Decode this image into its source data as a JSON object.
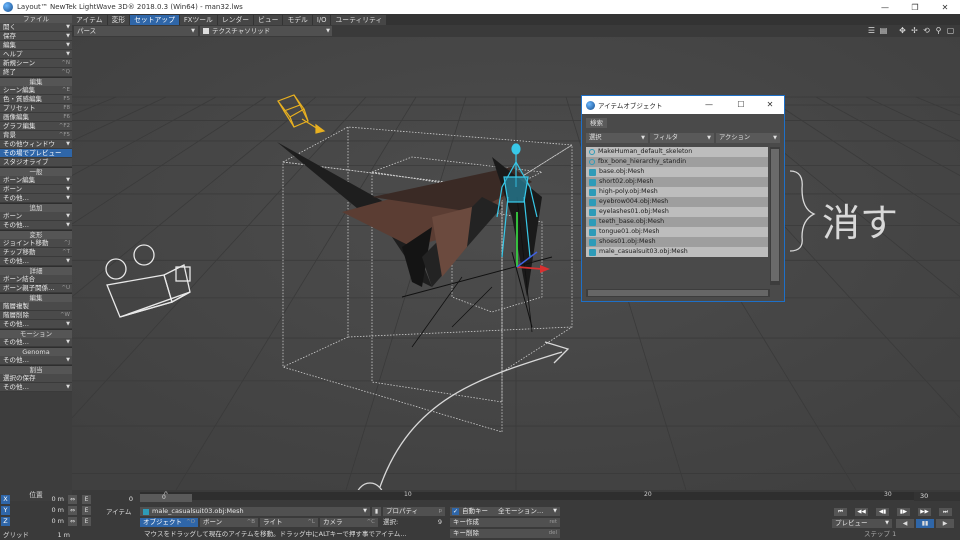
{
  "window": {
    "title": "Layout™ NewTek LightWave 3D® 2018.0.3 (Win64) - man32.lws",
    "minimize": "—",
    "maximize": "❐",
    "close": "✕"
  },
  "menu_tabs": [
    "アイテム",
    "変形",
    "セットアップ",
    "FXツール",
    "レンダー",
    "ビュー",
    "モデル",
    "I/O",
    "ユーティリティ"
  ],
  "active_tab": "セットアップ",
  "left_panel": [
    {
      "type": "header",
      "label": "ファイル"
    },
    {
      "type": "item",
      "label": "開く",
      "dropdown": true
    },
    {
      "type": "item",
      "label": "保存",
      "dropdown": true
    },
    {
      "type": "item",
      "label": "編集",
      "dropdown": true
    },
    {
      "type": "item",
      "label": "ヘルプ",
      "dropdown": true
    },
    {
      "type": "item",
      "label": "新規シーン",
      "shortcut": "^N"
    },
    {
      "type": "item",
      "label": "終了",
      "shortcut": "^Q"
    },
    {
      "type": "header",
      "label": "編集"
    },
    {
      "type": "item",
      "label": "シーン編集",
      "shortcut": "^E"
    },
    {
      "type": "item",
      "label": "色・質感編集",
      "shortcut": "F5"
    },
    {
      "type": "item",
      "label": "プリセット",
      "shortcut": "F8"
    },
    {
      "type": "item",
      "label": "画像編集",
      "shortcut": "F6"
    },
    {
      "type": "item",
      "label": "グラフ編集",
      "shortcut": "^F2"
    },
    {
      "type": "item",
      "label": "背景",
      "shortcut": "^F5"
    },
    {
      "type": "item",
      "label": "その他ウィンドウ",
      "dropdown": true
    },
    {
      "type": "item",
      "label": "その場でプレビュー",
      "active": true
    },
    {
      "type": "item",
      "label": "スタジオライブ"
    },
    {
      "type": "header",
      "label": "一般"
    },
    {
      "type": "item",
      "label": "ボーン編集",
      "dropdown": true
    },
    {
      "type": "item",
      "label": "ボーン",
      "dropdown": true
    },
    {
      "type": "item",
      "label": "その他…",
      "dropdown": true
    },
    {
      "type": "header",
      "label": "追加"
    },
    {
      "type": "item",
      "label": "ボーン",
      "dropdown": true
    },
    {
      "type": "item",
      "label": "その他…",
      "dropdown": true
    },
    {
      "type": "header",
      "label": "変形"
    },
    {
      "type": "item",
      "label": "ジョイント移動",
      "shortcut": "^J"
    },
    {
      "type": "item",
      "label": "チップ移動",
      "shortcut": "^T"
    },
    {
      "type": "item",
      "label": "その他…",
      "dropdown": true
    },
    {
      "type": "header",
      "label": "詳細"
    },
    {
      "type": "item",
      "label": "ボーン結合"
    },
    {
      "type": "item",
      "label": "ボーン親子関係…",
      "shortcut": "^U"
    },
    {
      "type": "header",
      "label": "編集"
    },
    {
      "type": "item",
      "label": "階層複製"
    },
    {
      "type": "item",
      "label": "階層削除",
      "shortcut": "^W"
    },
    {
      "type": "item",
      "label": "その他…",
      "dropdown": true
    },
    {
      "type": "header",
      "label": "モーション"
    },
    {
      "type": "item",
      "label": "その他…",
      "dropdown": true
    },
    {
      "type": "header",
      "label": "Genoma"
    },
    {
      "type": "item",
      "label": "その他…",
      "dropdown": true
    },
    {
      "type": "header",
      "label": "割当"
    },
    {
      "type": "item",
      "label": "選択の保存"
    },
    {
      "type": "item",
      "label": "その他…",
      "dropdown": true
    }
  ],
  "view_toolbar": {
    "view_type": "パース",
    "render_mode": "テクスチャソリッド",
    "icons": [
      "list-icon",
      "options-icon",
      "pan-icon",
      "move-icon",
      "rotate-icon",
      "zoom-icon",
      "maximize-icon"
    ]
  },
  "item_window": {
    "title": "アイテムオブジェクト",
    "search_label": "検索",
    "dropdowns": [
      "選択",
      "フィルタ",
      "アクション"
    ],
    "items": [
      {
        "name": "MakeHuman_default_skeleton",
        "kind": "bone"
      },
      {
        "name": "fbx_bone_hierarchy_standin",
        "kind": "bone"
      },
      {
        "name": "base.obj:Mesh",
        "kind": "mesh"
      },
      {
        "name": "short02.obj:Mesh",
        "kind": "mesh"
      },
      {
        "name": "high-poly.obj:Mesh",
        "kind": "mesh"
      },
      {
        "name": "eyebrow004.obj:Mesh",
        "kind": "mesh"
      },
      {
        "name": "eyelashes01.obj:Mesh",
        "kind": "mesh"
      },
      {
        "name": "teeth_base.obj:Mesh",
        "kind": "mesh"
      },
      {
        "name": "tongue01.obj:Mesh",
        "kind": "mesh"
      },
      {
        "name": "shoes01.obj:Mesh",
        "kind": "mesh"
      },
      {
        "name": "male_casualsuit03.obj:Mesh",
        "kind": "mesh"
      }
    ]
  },
  "annotation": {
    "text": "消す",
    "color": "#d8d8d8"
  },
  "timeline": {
    "ticks": [
      "0",
      "10",
      "20",
      "30"
    ],
    "current_frame": "0",
    "end_frame": "30",
    "position_label": "位置"
  },
  "bottom": {
    "axes": [
      {
        "axis": "X",
        "value": "0 m"
      },
      {
        "axis": "Y",
        "value": "0 m"
      },
      {
        "axis": "Z",
        "value": "0 m"
      }
    ],
    "edit_btn": "E",
    "frame_field": "0",
    "grid_label": "グリッド",
    "grid_value": "1 m",
    "item_label": "アイテム",
    "current_item": "male_casualsuit03.obj:Mesh",
    "properties_label": "プロパティ",
    "properties_shortcut": "p",
    "selected_label": "選択:",
    "selected_count": "9",
    "type_buttons": [
      {
        "label": "オブジェクト",
        "shortcut": "^O",
        "active": true
      },
      {
        "label": "ボーン",
        "shortcut": "^B"
      },
      {
        "label": "ライト",
        "shortcut": "^L"
      },
      {
        "label": "カメラ",
        "shortcut": "^C"
      }
    ],
    "status_message": "マウスをドラッグして現在のアイテムを移動。ドラッグ中にALTキーで押す事でアイテム…",
    "auto_key_label": "自動キー",
    "auto_key_mode": "全モーション…",
    "create_key": "キー作成",
    "create_key_shortcut": "ret",
    "delete_key": "キー削除",
    "delete_key_shortcut": "del",
    "preview_label": "プレビュー",
    "step_label": "ステップ",
    "step_value": "1",
    "playback": [
      "⏮",
      "◀◀",
      "◀▮",
      "▮▶",
      "▶▶",
      "⏭"
    ]
  },
  "colors": {
    "accent": "#2f66a8",
    "panel": "#3d3d3d",
    "viewport": "#474747",
    "bone_cyan": "#38c8e8",
    "camera_light": "#e8b020"
  }
}
